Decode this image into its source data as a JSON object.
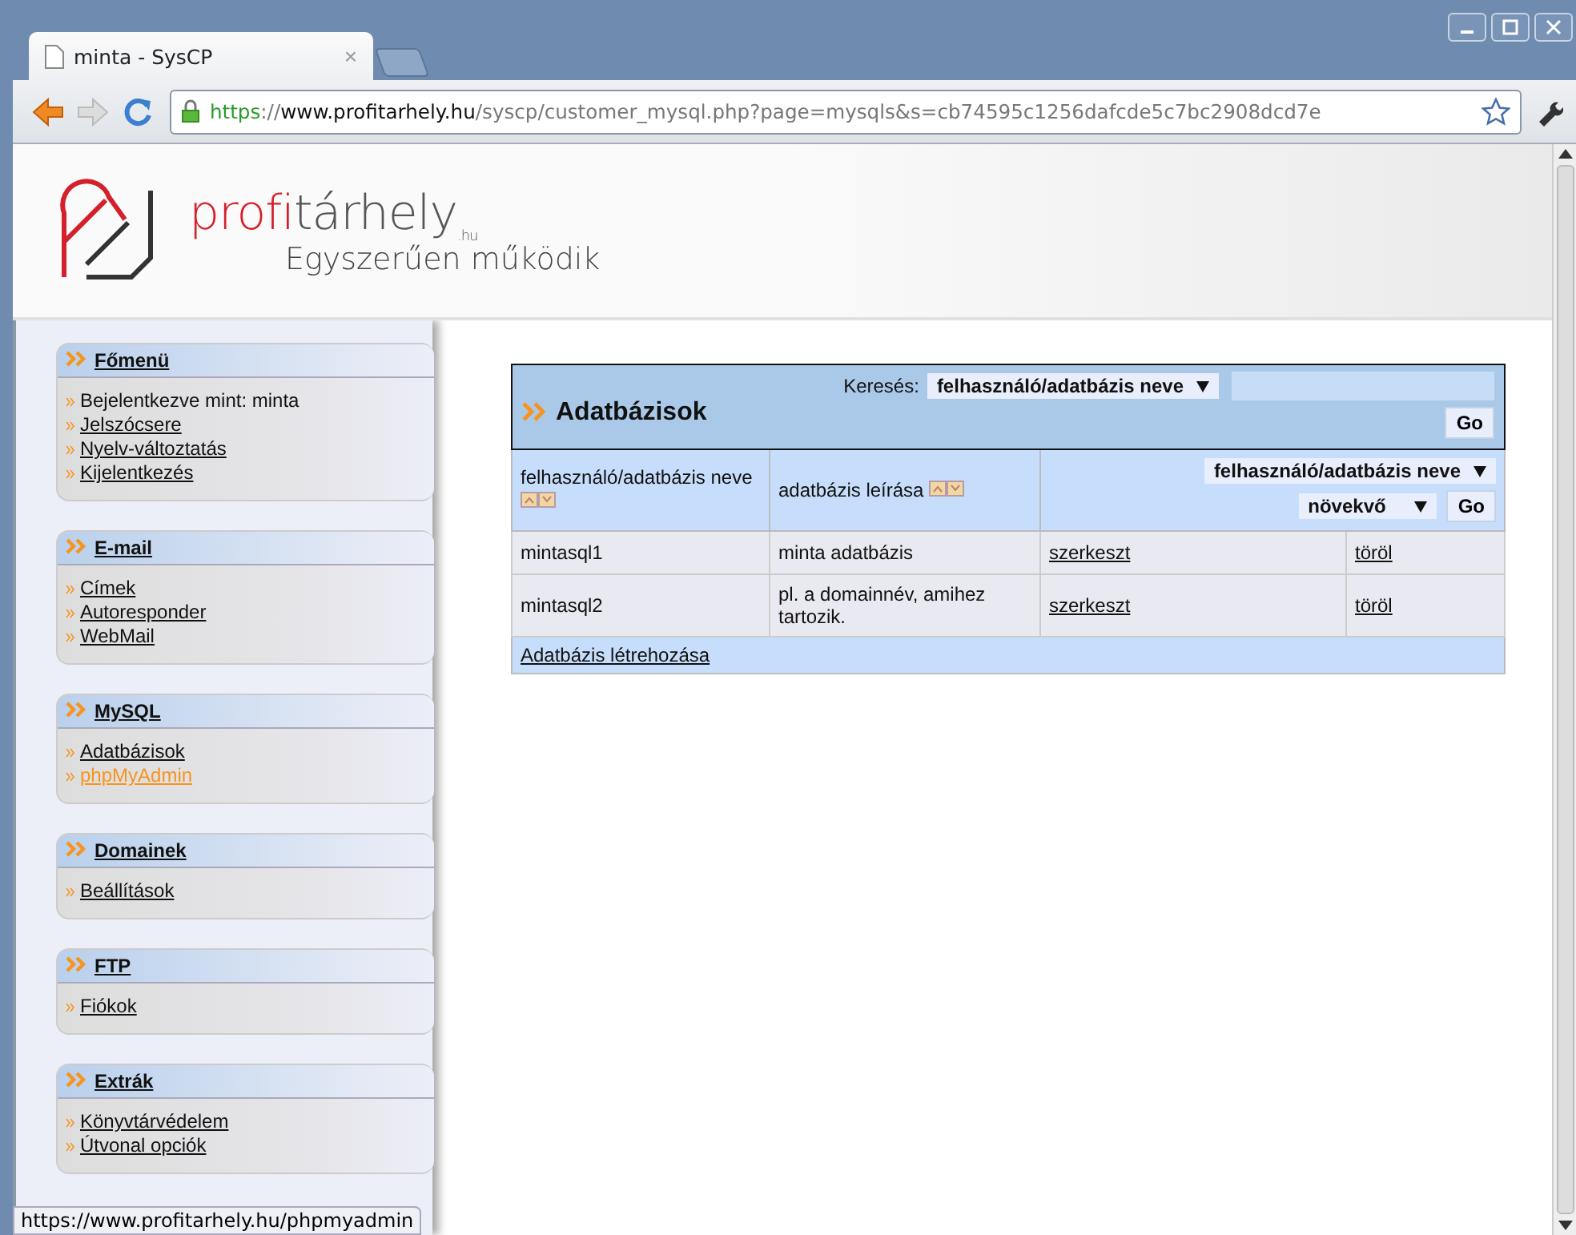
{
  "browser": {
    "tab": {
      "title": "minta - SysCP",
      "close": "×"
    },
    "url_parts": [
      {
        "kind": "scheme",
        "text": "https"
      },
      {
        "kind": "sep",
        "text": "://"
      },
      {
        "kind": "host",
        "text": "www.profitarhely.hu"
      },
      {
        "kind": "path",
        "text": "/syscp/customer_mysql.php?page=mysqls&s=cb74595c1256dafcde5c7bc2908dcd7e"
      }
    ]
  },
  "logo": {
    "accent": "profi",
    "name": "tárhely",
    "suffix": ".hu",
    "tagline": "Egyszerűen működik"
  },
  "sidebar": [
    {
      "title": "Főmenü",
      "items": [
        {
          "kind": "text",
          "label": "Bejelentkezve mint: minta",
          "hovered": false
        },
        {
          "kind": "link",
          "label": "Jelszócsere",
          "hovered": false
        },
        {
          "kind": "link",
          "label": "Nyelv-változtatás",
          "hovered": false
        },
        {
          "kind": "link",
          "label": "Kijelentkezés",
          "hovered": false
        }
      ]
    },
    {
      "title": "E-mail",
      "items": [
        {
          "kind": "link",
          "label": "Címek",
          "hovered": false
        },
        {
          "kind": "link",
          "label": "Autoresponder",
          "hovered": false
        },
        {
          "kind": "link",
          "label": "WebMail",
          "hovered": false
        }
      ]
    },
    {
      "title": "MySQL",
      "items": [
        {
          "kind": "link",
          "label": "Adatbázisok",
          "hovered": false
        },
        {
          "kind": "link",
          "label": "phpMyAdmin",
          "hovered": true
        }
      ]
    },
    {
      "title": "Domainek",
      "items": [
        {
          "kind": "link",
          "label": "Beállítások",
          "hovered": false
        }
      ]
    },
    {
      "title": "FTP",
      "items": [
        {
          "kind": "link",
          "label": "Fiókok",
          "hovered": false
        }
      ]
    },
    {
      "title": "Extrák",
      "items": [
        {
          "kind": "link",
          "label": "Könyvtárvédelem",
          "hovered": false
        },
        {
          "kind": "link",
          "label": "Útvonal opciók",
          "hovered": false
        }
      ]
    }
  ],
  "panel": {
    "title": "Adatbázisok",
    "search": {
      "label": "Keresés:",
      "field": "felhasználó/adatbázis neve",
      "button": "Go"
    },
    "columns": [
      "felhasználó/adatbázis neve",
      "adatbázis leírása"
    ],
    "sort": {
      "field": "felhasználó/adatbázis neve",
      "order": "növekvő",
      "button": "Go"
    },
    "rows": [
      {
        "name": "mintasql1",
        "description": "minta adatbázis",
        "edit": "szerkeszt",
        "delete": "töröl"
      },
      {
        "name": "mintasql2",
        "description": "pl. a domainnév, amihez tartozik.",
        "edit": "szerkeszt",
        "delete": "töröl"
      }
    ],
    "create": "Adatbázis létrehozása"
  },
  "status_bubble": "https://www.profitarhely.hu/phpmyadmin"
}
